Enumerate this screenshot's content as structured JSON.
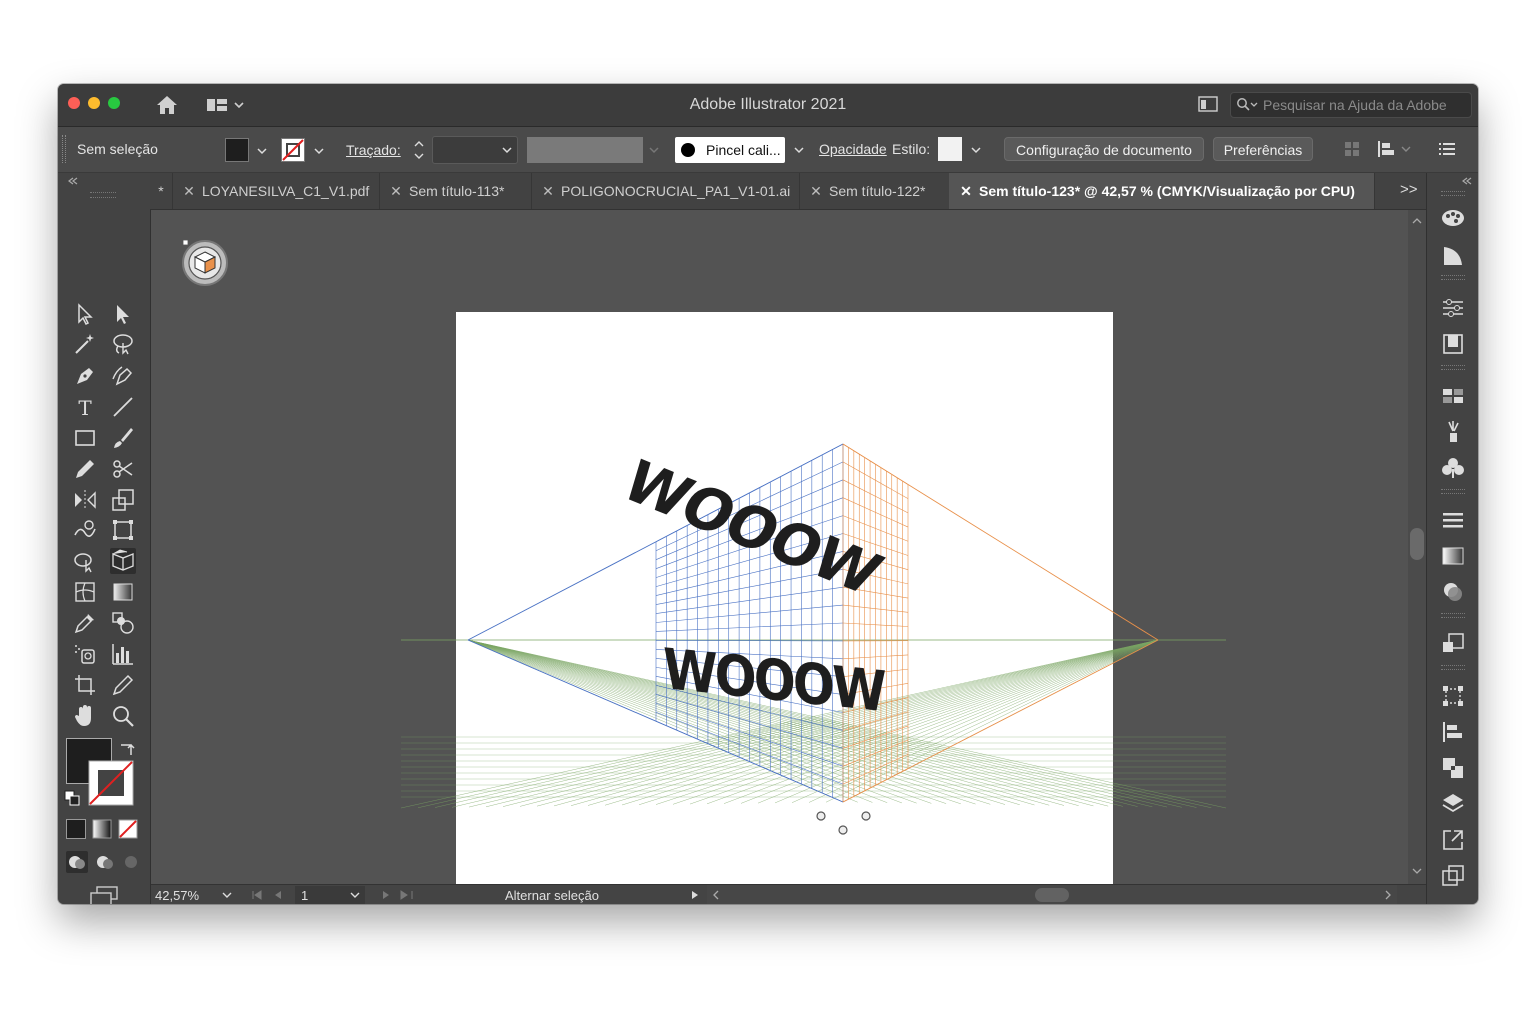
{
  "window": {
    "title": "Adobe Illustrator 2021"
  },
  "search": {
    "placeholder": "Pesquisar na Ajuda da Adobe"
  },
  "controlbar": {
    "selection_label": "Sem seleção",
    "stroke_label": "Traçado:",
    "brush_label": "Pincel cali...",
    "opacity_label": "Opacidade",
    "style_label": "Estilo:",
    "doc_setup_label": "Configuração de documento",
    "preferences_label": "Preferências"
  },
  "tabs": [
    {
      "label": "*",
      "active": false
    },
    {
      "label": "LOYANESILVA_C1_V1.pdf",
      "active": false
    },
    {
      "label": "Sem título-113*",
      "active": false
    },
    {
      "label": "POLIGONOCRUCIAL_PA1_V1-01.ai",
      "active": false
    },
    {
      "label": "Sem título-122*",
      "active": false
    },
    {
      "label": "Sem título-123* @ 42,57 % (CMYK/Visualização por CPU)",
      "active": true
    }
  ],
  "tab_overflow": ">>",
  "artwork": {
    "text_top": "WOOOW",
    "text_bottom": "WOOOW",
    "text_color": "#1e1e1e",
    "grid_left_color": "#4a72c4",
    "grid_right_color": "#e8904a",
    "ground_color": "#7aa563"
  },
  "statusbar": {
    "zoom": "42,57%",
    "artboard_number": "1",
    "toggle_label": "Alternar seleção"
  },
  "colors": {
    "fill": "#1e1e1e",
    "window_bg": "#535353",
    "titlebar": "#3c3c3c"
  },
  "icons": {
    "tools_left": [
      "selection-tool-icon",
      "direct-selection-tool-icon",
      "magic-wand-icon",
      "lasso-icon",
      "pen-tool-icon",
      "curvature-tool-icon",
      "type-tool-icon",
      "line-tool-icon",
      "rectangle-tool-icon",
      "paintbrush-tool-icon",
      "pencil-tool-icon",
      "scissors-tool-icon",
      "reflect-tool-icon",
      "scale-tool-icon",
      "warp-tool-icon",
      "free-transform-icon",
      "shape-builder-icon",
      "perspective-grid-icon",
      "mesh-tool-icon",
      "gradient-tool-icon",
      "eyedropper-icon",
      "blend-tool-icon",
      "symbol-sprayer-icon",
      "column-graph-icon",
      "artboard-tool-icon",
      "slice-tool-icon",
      "hand-tool-icon",
      "zoom-tool-icon"
    ],
    "panels_right": [
      "color-panel-icon",
      "color-guide-icon",
      "properties-icon",
      "libraries-icon",
      "swatches-icon",
      "brushes-icon",
      "symbols-icon",
      "stroke-icon",
      "gradient-icon",
      "transparency-icon",
      "appearance-icon",
      "transform-icon",
      "align-icon",
      "pathfinder-icon",
      "layers-icon",
      "export-icon",
      "artboards-icon"
    ]
  }
}
